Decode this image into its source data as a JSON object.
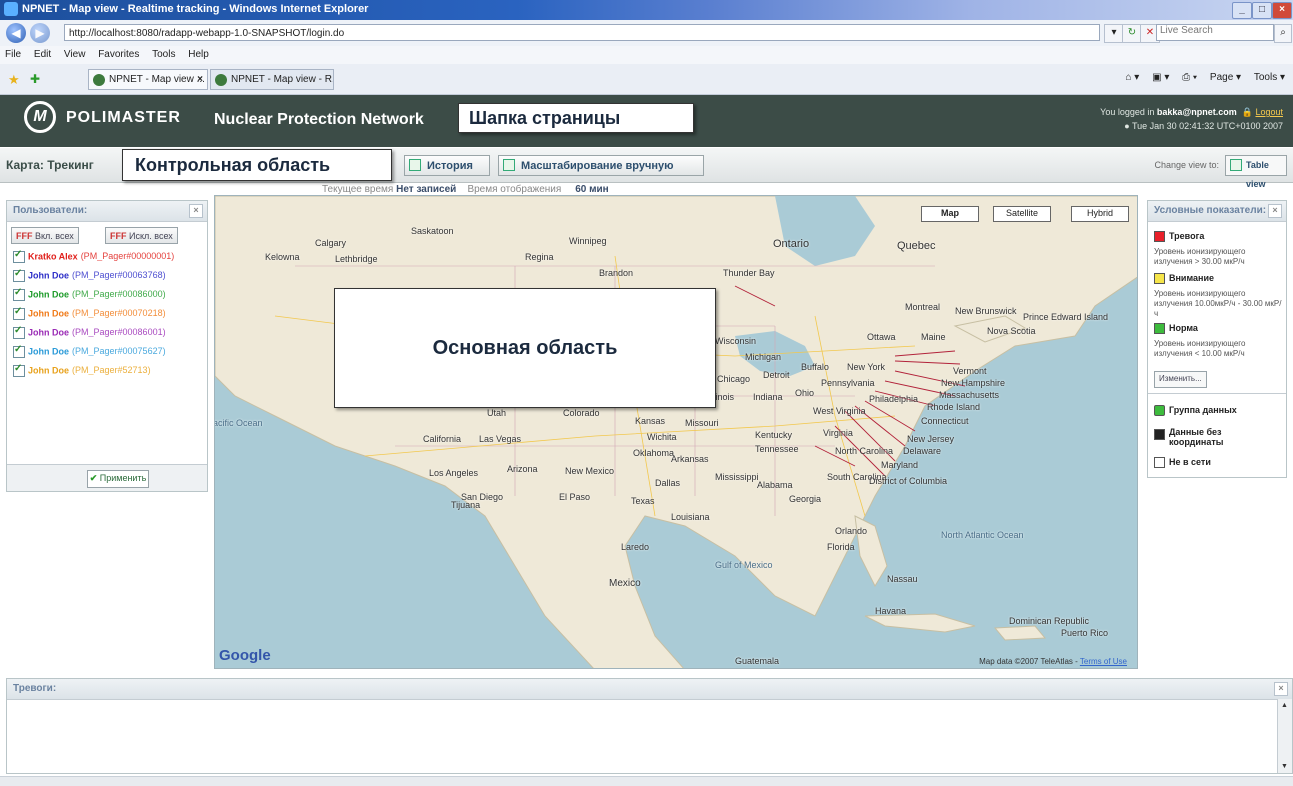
{
  "browser": {
    "window_title": "NPNET - Map view - Realtime tracking - Windows Internet Explorer",
    "url": "http://localhost:8080/radapp-webapp-1.0-SNAPSHOT/login.do",
    "search_placeholder": "Live Search",
    "menu": [
      "File",
      "Edit",
      "View",
      "Favorites",
      "Tools",
      "Help"
    ],
    "tabs": [
      "NPNET - Map view ...",
      "NPNET - Map view - R..."
    ],
    "commands": [
      "Page ▾",
      "Tools ▾"
    ]
  },
  "header": {
    "logo_text": "POLIMASTER",
    "product_name": "Nuclear Protection Network",
    "logged_in_prefix": "You logged in",
    "user_email": "bakka@npnet.com",
    "logout_label": "Logout",
    "datetime": "Tue Jan 30 02:41:32 UTC+0100 2007"
  },
  "annotations": {
    "header": "Шапка страницы",
    "control": "Контрольная область",
    "main": "Основная область"
  },
  "controls": {
    "page_title": "Карта: Трекинг",
    "history_button": "История",
    "manual_zoom_button": "Масштабирование вручную",
    "change_view_label": "Change view to:",
    "table_view_button": "Table view"
  },
  "status": {
    "current_time_label": "Текущее время",
    "current_time_value": "Нет записей",
    "display_time_label": "Время отображения",
    "display_time_value": "60 мин"
  },
  "users_panel": {
    "title": "Пользователи:",
    "select_all": "Вкл. всех",
    "deselect_all": "Искл. всех",
    "apply": "Применить",
    "users": [
      {
        "name": "Kratko Alex",
        "device": "(PM_Pager#00000001)",
        "color": "#e0201c"
      },
      {
        "name": "John Doe",
        "device": "(PM_Pager#00063768)",
        "color": "#2d2fc8"
      },
      {
        "name": "John Doe",
        "device": "(PM_Pager#00086000)",
        "color": "#1e9b2a"
      },
      {
        "name": "John Doe",
        "device": "(PM_Pager#00070218)",
        "color": "#f07a18"
      },
      {
        "name": "John Doe",
        "device": "(PM_Pager#00086001)",
        "color": "#9a2bb5"
      },
      {
        "name": "John Doe",
        "device": "(PM_Pager#00075627)",
        "color": "#2a9ad8"
      },
      {
        "name": "John Doe",
        "device": "(PM_Pager#52713)",
        "color": "#e8a21c"
      }
    ]
  },
  "map": {
    "buttons": [
      "Map",
      "Satellite",
      "Hybrid"
    ],
    "provider": "Google",
    "credit": "Map data ©2007 TeleAtlas -",
    "terms": "Terms of Use",
    "labels": [
      "Ontario",
      "Quebec",
      "Calgary",
      "Saskatoon",
      "Winnipeg",
      "Regina",
      "Kelowna",
      "Lethbridge",
      "Brandon",
      "Thunder Bay",
      "Montreal",
      "Ottawa",
      "Maine",
      "Nova Scotia",
      "Prince Edward Island",
      "New Brunswick",
      "Wisconsin",
      "Michigan",
      "Detroit",
      "Buffalo",
      "New York",
      "Vermont",
      "New Hampshire",
      "Massachusetts",
      "Rhode Island",
      "Connecticut",
      "New Jersey",
      "Delaware",
      "Maryland",
      "Chicago",
      "Illinois",
      "Indiana",
      "Ohio",
      "Pennsylvania",
      "Philadelphia",
      "West Virginia",
      "Virginia",
      "Kentucky",
      "Tennessee",
      "North Carolina",
      "South Carolina",
      "District of Columbia",
      "Georgia",
      "Alabama",
      "Mississippi",
      "Louisiana",
      "Arkansas",
      "Oklahoma",
      "Kansas",
      "Missouri",
      "Colorado",
      "Utah",
      "Arizona",
      "New Mexico",
      "Texas",
      "California",
      "Las Vegas",
      "Los Angeles",
      "San Diego",
      "Florida",
      "Orlando",
      "Mexico",
      "Gulf of Mexico",
      "North Atlantic Ocean",
      "Dominican Republic",
      "Puerto Rico",
      "Guatemala",
      "Pacific Ocean",
      "Havana",
      "Nassau",
      "Dallas",
      "El Paso",
      "Wichita",
      "Tijuana",
      "Laredo"
    ]
  },
  "legend": {
    "title": "Условные показатели:",
    "items": [
      {
        "label": "Тревога",
        "desc": "Уровень ионизирующего излучения > 30.00 мкР/ч",
        "color": "#e8202a"
      },
      {
        "label": "Внимание",
        "desc": "Уровень ионизирующего излучения 10.00мкР/ч - 30.00 мкР/ч",
        "color": "#f6e54a"
      },
      {
        "label": "Норма",
        "desc": "Уровень ионизирующего излучения < 10.00 мкР/ч",
        "color": "#3dbb3d"
      }
    ],
    "change_button": "Изменить...",
    "group_label": "Группа данных",
    "no_coords_label": "Данные без координаты",
    "offline_label": "Не в сети"
  },
  "alarms": {
    "title": "Тревоги:"
  }
}
